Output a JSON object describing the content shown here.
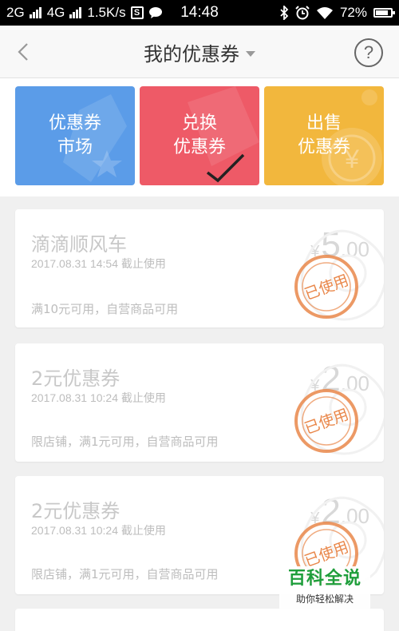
{
  "status_bar": {
    "network1": "2G",
    "network2": "4G",
    "speed": "1.5K/s",
    "s_icon": "S",
    "time": "14:48",
    "battery": "72%"
  },
  "header": {
    "title": "我的优惠券",
    "help": "?"
  },
  "tiles": [
    {
      "line1": "优惠券",
      "line2": "市场",
      "color": "#5b9ce8"
    },
    {
      "line1": "兑换",
      "line2": "优惠券",
      "color": "#ee5a67"
    },
    {
      "line1": "出售",
      "line2": "优惠券",
      "color": "#f2b73d"
    }
  ],
  "coupons": [
    {
      "title": "滴滴顺风车",
      "date": "2017.08.31 14:54 截止使用",
      "desc": "满10元可用，自营商品可用",
      "yen": "¥",
      "int": "5",
      "dec": ".00",
      "stamp": "已使用"
    },
    {
      "title": "2元优惠券",
      "date": "2017.08.31 10:24 截止使用",
      "desc": "限店铺，满1元可用，自营商品可用",
      "yen": "¥",
      "int": "2",
      "dec": ".00",
      "stamp": "已使用"
    },
    {
      "title": "2元优惠券",
      "date": "2017.08.31 10:24 截止使用",
      "desc": "限店铺，满1元可用，自营商品可用",
      "yen": "¥",
      "int": "2",
      "dec": ".00",
      "stamp": "已使用"
    }
  ],
  "badge": {
    "title": "百科全说",
    "subtitle": "助你轻松解决"
  },
  "colors": {
    "stamp": "#e9874a",
    "accent_green": "#1f9e3b"
  }
}
